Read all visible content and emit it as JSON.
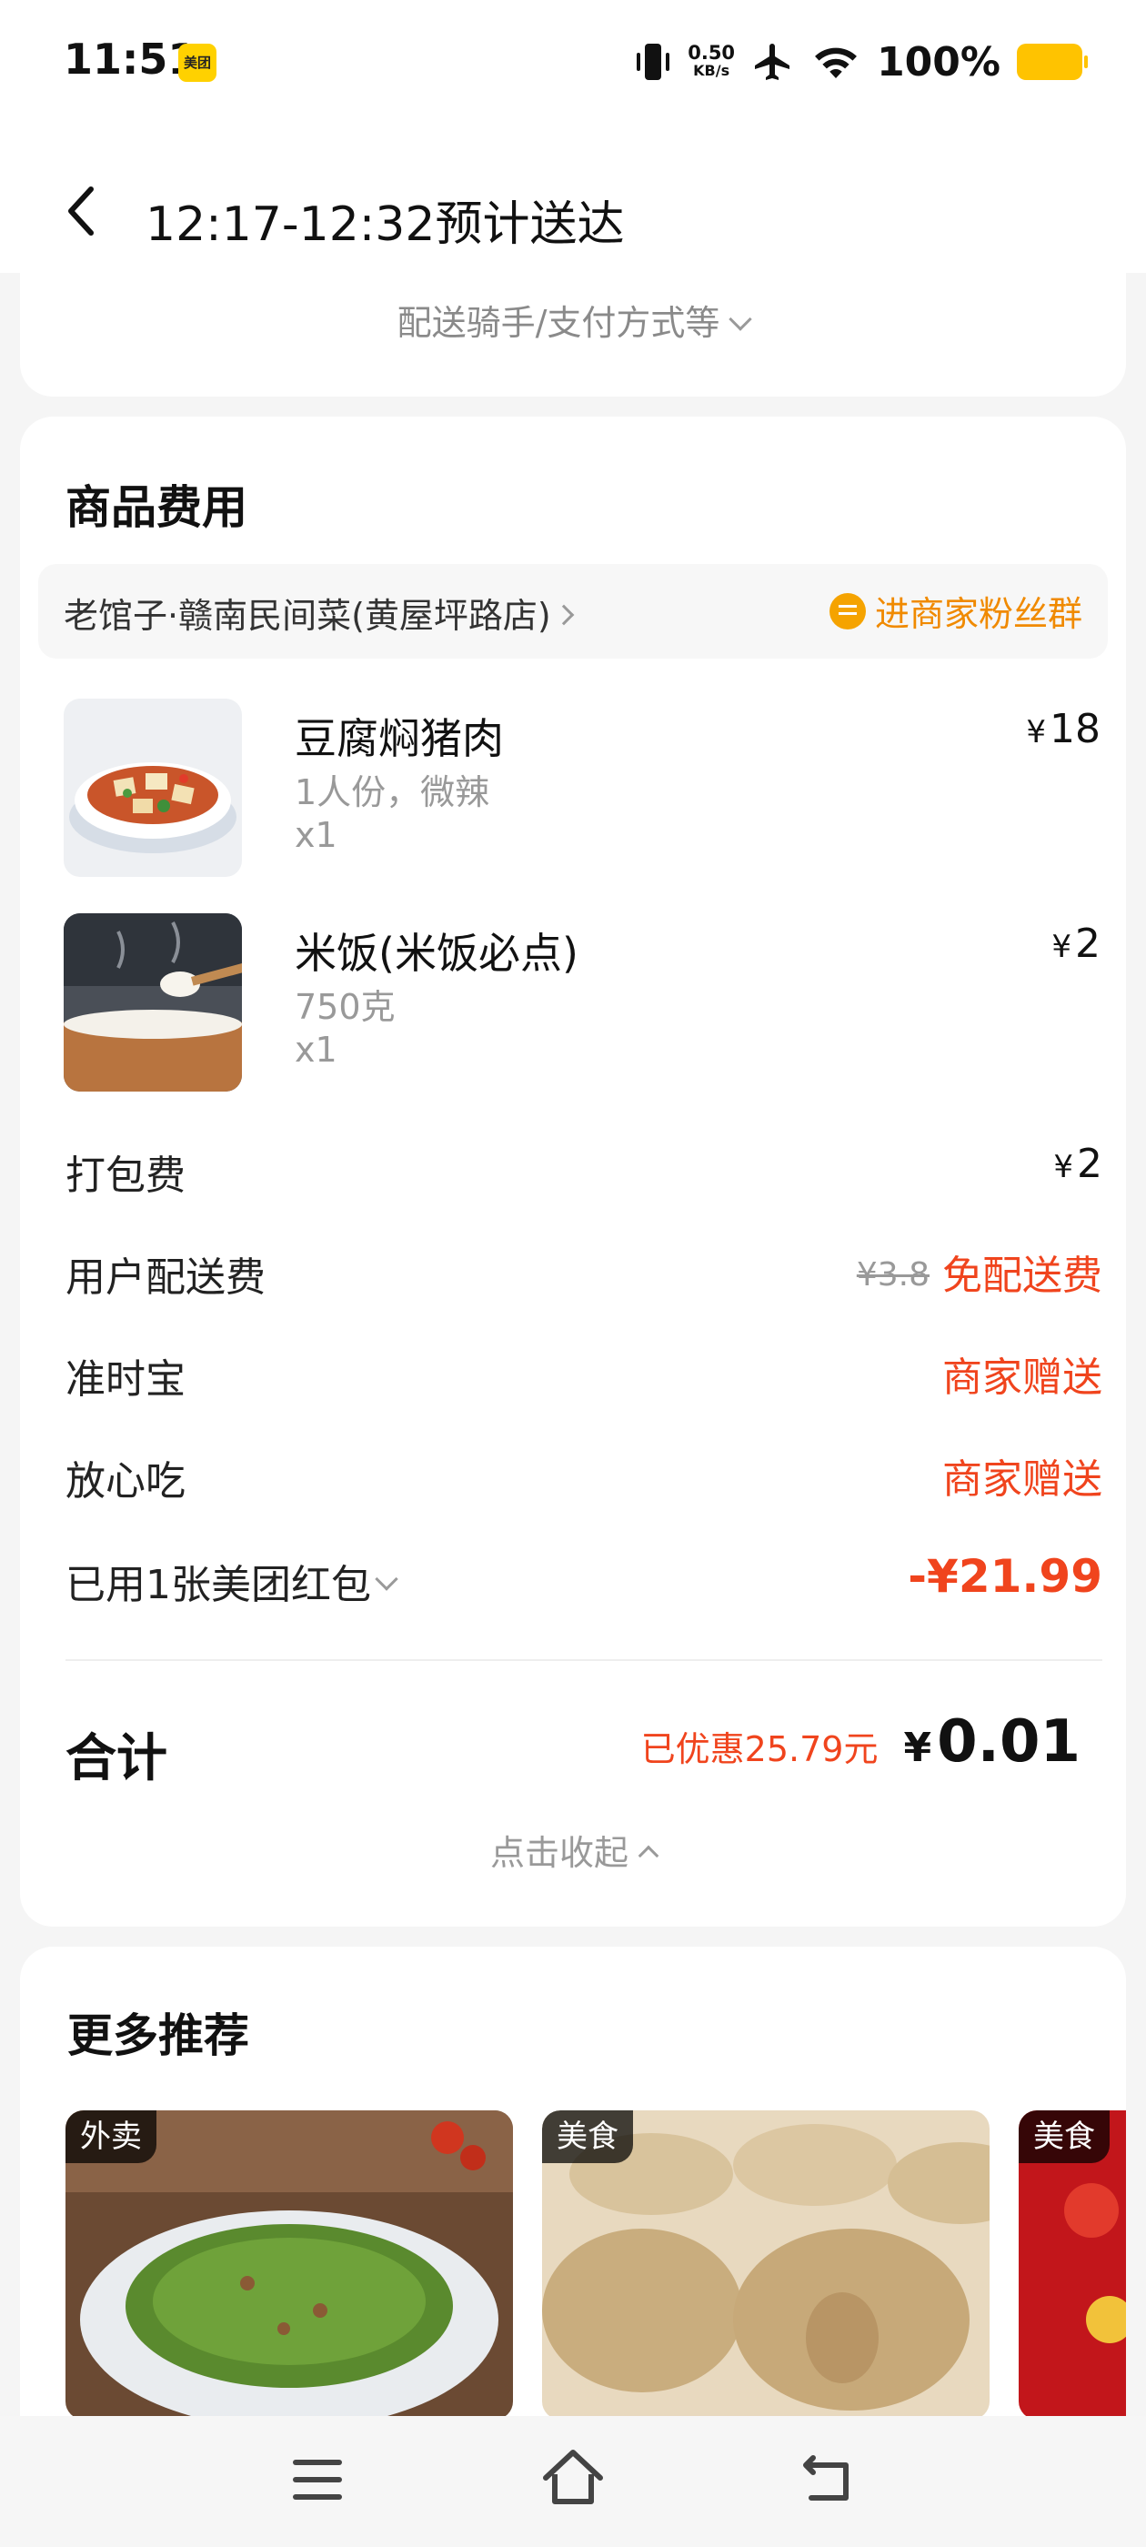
{
  "status_bar": {
    "time": "11:51",
    "app_badge": "美团",
    "net_speed_value": "0.50",
    "net_speed_unit": "KB/s",
    "battery": "100%",
    "icons": [
      "vibrate-icon",
      "airplane-icon",
      "wifi-icon",
      "battery-icon"
    ]
  },
  "header": {
    "title": "12:17-12:32预计送达",
    "back_icon": "chevron-left-icon"
  },
  "delivery_toggle": "配送骑手/支付方式等",
  "goods": {
    "section_title": "商品费用",
    "shop_name": "老馆子·赣南民间菜(黄屋坪路店)",
    "fans_group": "进商家粉丝群",
    "items": [
      {
        "name": "豆腐焖猪肉",
        "spec": "1人份，微辣",
        "qty": "x1",
        "currency": "¥",
        "price": "18"
      },
      {
        "name": "米饭(米饭必点)",
        "spec": "750克",
        "qty": "x1",
        "currency": "¥",
        "price": "2"
      }
    ],
    "fees": {
      "packing_label": "打包费",
      "packing_currency": "¥",
      "packing_value": "2",
      "delivery_label": "用户配送费",
      "delivery_original": "¥3.8",
      "delivery_value": "免配送费",
      "ontime_label": "准时宝",
      "ontime_value": "商家赠送",
      "safe_label": "放心吃",
      "safe_value": "商家赠送",
      "redbag_label": "已用1张美团红包",
      "redbag_value": "-¥21.99"
    },
    "total": {
      "label": "合计",
      "saved": "已优惠25.79元",
      "currency": "¥",
      "value": "0.01"
    },
    "collapse": "点击收起"
  },
  "recommend": {
    "title": "更多推荐",
    "cards": [
      {
        "tag": "外卖"
      },
      {
        "tag": "美食"
      },
      {
        "tag": "美食"
      }
    ]
  },
  "colors": {
    "accent_red": "#f0441d",
    "accent_orange": "#f08a00",
    "meituan_yellow": "#ffd100"
  }
}
